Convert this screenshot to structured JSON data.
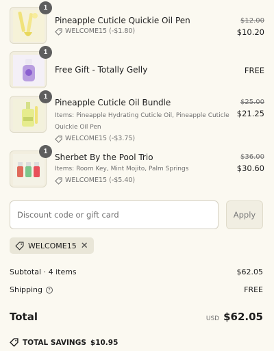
{
  "items": [
    {
      "name": "Pineapple Cuticle Quickie Oil Pen",
      "qty": "1",
      "items_text": "",
      "discount": "WELCOME15 (-$1.80)",
      "old_price": "$12.00",
      "new_price": "$10.20"
    },
    {
      "name": "Free Gift - Totally Gelly",
      "qty": "1",
      "items_text": "",
      "discount": "",
      "old_price": "",
      "new_price": "FREE"
    },
    {
      "name": "Pineapple Cuticle Oil Bundle",
      "qty": "1",
      "items_text": "Items: Pineapple Hydrating Cuticle Oil, Pineapple Cuticle Quickie Oil Pen",
      "discount": "WELCOME15 (-$3.75)",
      "old_price": "$25.00",
      "new_price": "$21.25"
    },
    {
      "name": "Sherbet By the Pool Trio",
      "qty": "1",
      "items_text": "Items: Room Key, Mint Mojito, Palm Springs",
      "discount": "WELCOME15 (-$5.40)",
      "old_price": "$36.00",
      "new_price": "$30.60"
    }
  ],
  "discount_field": {
    "placeholder": "Discount code or gift card",
    "apply_label": "Apply"
  },
  "applied_code": "WELCOME15",
  "summary": {
    "subtotal_label": "Subtotal · 4 items",
    "subtotal_value": "$62.05",
    "shipping_label": "Shipping",
    "shipping_value": "FREE",
    "total_label": "Total",
    "currency": "USD",
    "total_value": "$62.05",
    "savings_label": "TOTAL SAVINGS",
    "savings_value": "$10.95"
  }
}
